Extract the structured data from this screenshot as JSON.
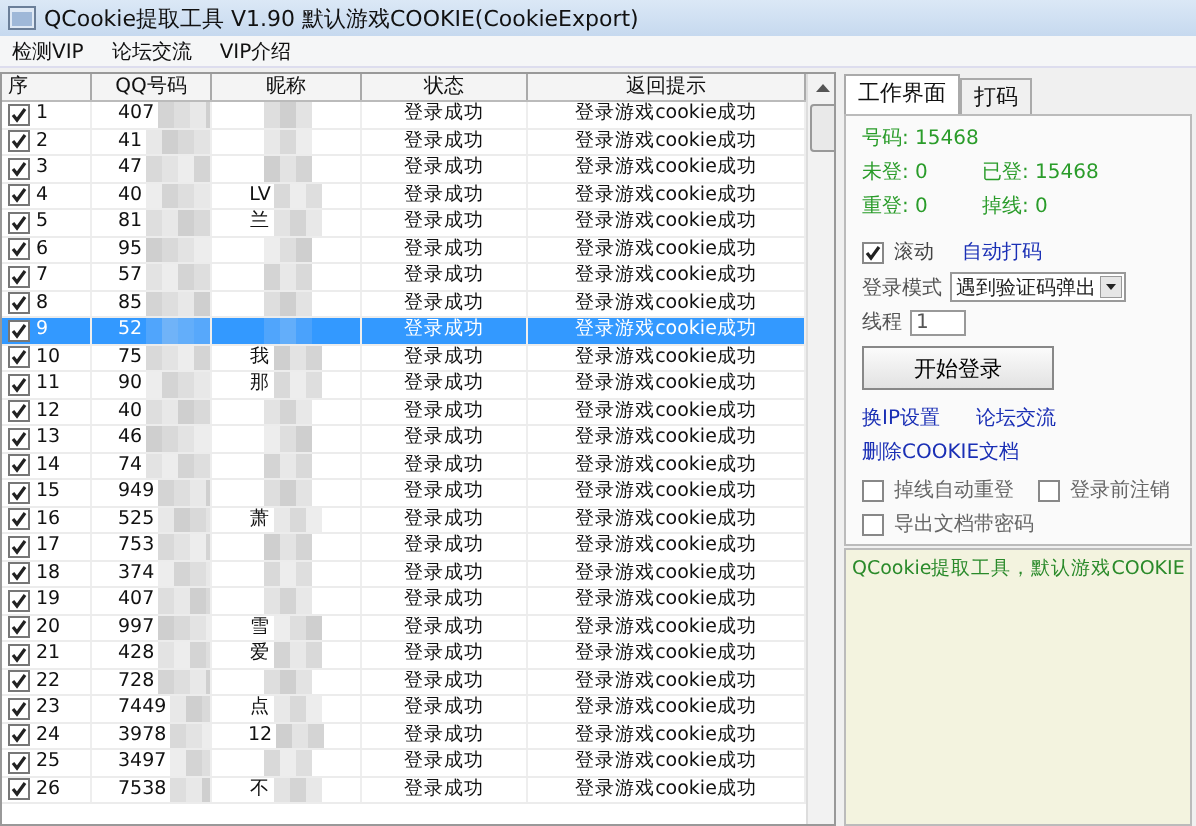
{
  "window": {
    "title": "QCookie提取工具 V1.90 默认游戏COOKIE(CookieExport)"
  },
  "menu": [
    "检测VIP",
    "论坛交流",
    "VIP介绍"
  ],
  "table": {
    "columns": [
      "序",
      "QQ号码",
      "昵称",
      "状态",
      "返回提示"
    ],
    "rows": [
      {
        "index": "1",
        "qq": "407",
        "checked": true,
        "selected": false,
        "status": "登录成功",
        "message": "登录游戏cookie成功"
      },
      {
        "index": "2",
        "qq": "41",
        "checked": true,
        "selected": false,
        "status": "登录成功",
        "message": "登录游戏cookie成功"
      },
      {
        "index": "3",
        "qq": "47",
        "checked": true,
        "selected": false,
        "status": "登录成功",
        "message": "登录游戏cookie成功"
      },
      {
        "index": "4",
        "qq": "40",
        "nick": "LV",
        "checked": true,
        "selected": false,
        "status": "登录成功",
        "message": "登录游戏cookie成功"
      },
      {
        "index": "5",
        "qq": "81",
        "nick": "兰",
        "checked": true,
        "selected": false,
        "status": "登录成功",
        "message": "登录游戏cookie成功"
      },
      {
        "index": "6",
        "qq": "95",
        "checked": true,
        "selected": false,
        "status": "登录成功",
        "message": "登录游戏cookie成功"
      },
      {
        "index": "7",
        "qq": "57",
        "checked": true,
        "selected": false,
        "status": "登录成功",
        "message": "登录游戏cookie成功"
      },
      {
        "index": "8",
        "qq": "85",
        "checked": true,
        "selected": false,
        "status": "登录成功",
        "message": "登录游戏cookie成功"
      },
      {
        "index": "9",
        "qq": "52",
        "checked": true,
        "selected": true,
        "status": "登录成功",
        "message": "登录游戏cookie成功"
      },
      {
        "index": "10",
        "qq": "75",
        "nick": "我",
        "checked": true,
        "selected": false,
        "status": "登录成功",
        "message": "登录游戏cookie成功"
      },
      {
        "index": "11",
        "qq": "90",
        "nick": "那",
        "checked": true,
        "selected": false,
        "status": "登录成功",
        "message": "登录游戏cookie成功"
      },
      {
        "index": "12",
        "qq": "40",
        "checked": true,
        "selected": false,
        "status": "登录成功",
        "message": "登录游戏cookie成功"
      },
      {
        "index": "13",
        "qq": "46",
        "checked": true,
        "selected": false,
        "status": "登录成功",
        "message": "登录游戏cookie成功"
      },
      {
        "index": "14",
        "qq": "74",
        "checked": true,
        "selected": false,
        "status": "登录成功",
        "message": "登录游戏cookie成功"
      },
      {
        "index": "15",
        "qq": "949",
        "checked": true,
        "selected": false,
        "status": "登录成功",
        "message": "登录游戏cookie成功"
      },
      {
        "index": "16",
        "qq": "525",
        "nick": "萧",
        "checked": true,
        "selected": false,
        "status": "登录成功",
        "message": "登录游戏cookie成功"
      },
      {
        "index": "17",
        "qq": "753",
        "checked": true,
        "selected": false,
        "status": "登录成功",
        "message": "登录游戏cookie成功"
      },
      {
        "index": "18",
        "qq": "374",
        "checked": true,
        "selected": false,
        "status": "登录成功",
        "message": "登录游戏cookie成功"
      },
      {
        "index": "19",
        "qq": "407",
        "checked": true,
        "selected": false,
        "status": "登录成功",
        "message": "登录游戏cookie成功"
      },
      {
        "index": "20",
        "qq": "997",
        "nick": "雪",
        "checked": true,
        "selected": false,
        "status": "登录成功",
        "message": "登录游戏cookie成功"
      },
      {
        "index": "21",
        "qq": "428",
        "nick": "爱",
        "checked": true,
        "selected": false,
        "status": "登录成功",
        "message": "登录游戏cookie成功"
      },
      {
        "index": "22",
        "qq": "728",
        "checked": true,
        "selected": false,
        "status": "登录成功",
        "message": "登录游戏cookie成功"
      },
      {
        "index": "23",
        "qq": "7449",
        "nick": "点",
        "checked": true,
        "selected": false,
        "status": "登录成功",
        "message": "登录游戏cookie成功"
      },
      {
        "index": "24",
        "qq": "3978",
        "nick": "12",
        "checked": true,
        "selected": false,
        "status": "登录成功",
        "message": "登录游戏cookie成功"
      },
      {
        "index": "25",
        "qq": "3497",
        "checked": true,
        "selected": false,
        "status": "登录成功",
        "message": "登录游戏cookie成功"
      },
      {
        "index": "26",
        "qq": "7538",
        "nick": "不",
        "checked": true,
        "selected": false,
        "status": "登录成功",
        "message": "登录游戏cookie成功"
      }
    ]
  },
  "panel": {
    "tabs": [
      {
        "label": "工作界面",
        "selected": true
      },
      {
        "label": "打码",
        "selected": false
      }
    ],
    "stats": [
      {
        "label": "号码:",
        "value": "15468"
      },
      {
        "label": "未登:",
        "value": "0"
      },
      {
        "label": "已登:",
        "value": "15468"
      },
      {
        "label": "重登:",
        "value": "0"
      },
      {
        "label": "掉线:",
        "value": "0"
      }
    ],
    "scroll_option": {
      "label": "滚动",
      "checked": true
    },
    "auto_captcha_link": "自动打码",
    "login_mode": {
      "label": "登录模式",
      "value": "遇到验证码弹出"
    },
    "threads": {
      "label": "线程",
      "value": "1"
    },
    "start_button": "开始登录",
    "links": [
      "换IP设置",
      "论坛交流",
      "删除COOKIE文档"
    ],
    "options": [
      {
        "label": "掉线自动重登",
        "checked": false
      },
      {
        "label": "登录前注销",
        "checked": false
      },
      {
        "label": "导出文档带密码",
        "checked": false
      }
    ],
    "log": "QCookie提取工具，默认游戏COOKIE"
  }
}
